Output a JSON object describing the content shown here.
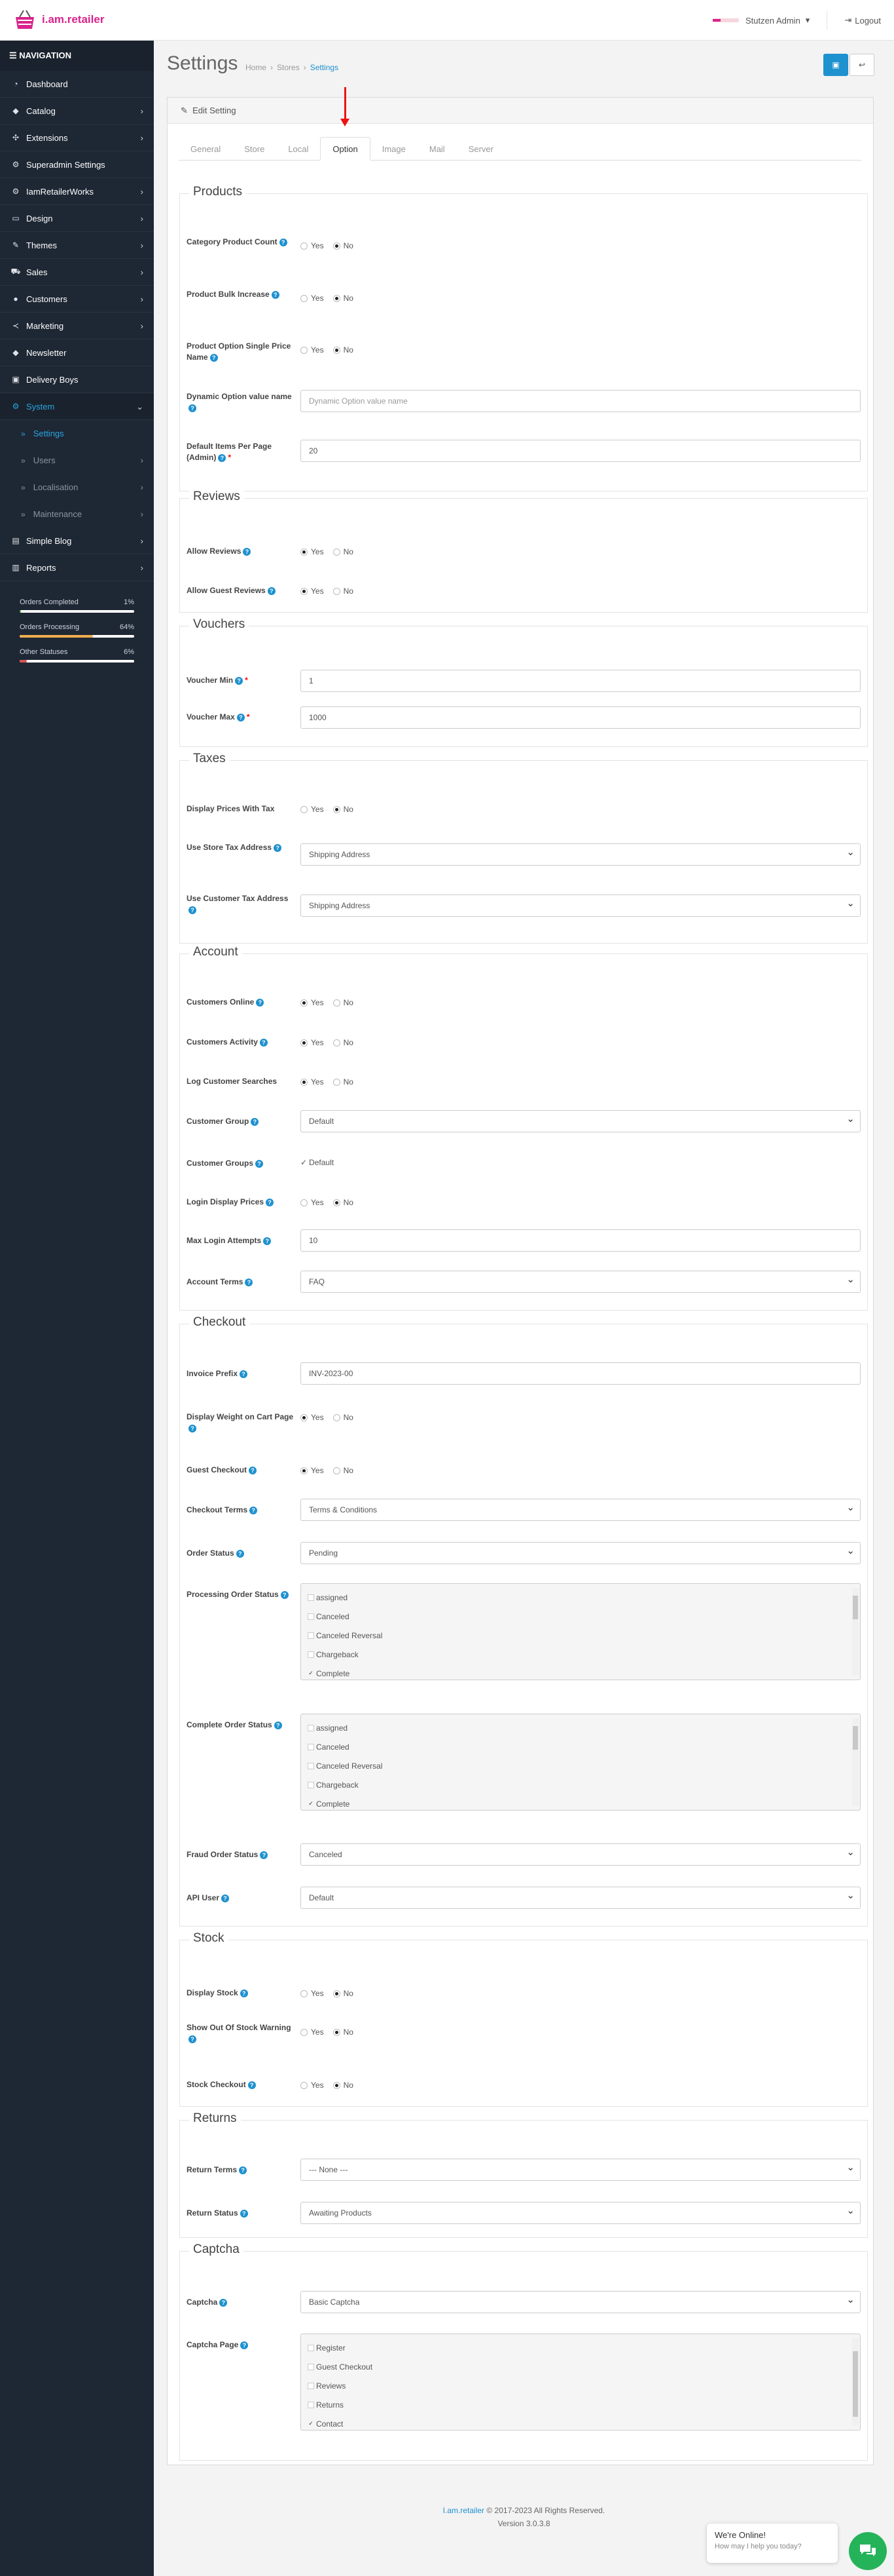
{
  "header": {
    "logo_text": "i.am.retailer",
    "user": "Stutzen Admin",
    "logout": "Logout"
  },
  "sidebar": {
    "heading": "NAVIGATION",
    "items": [
      {
        "label": "Dashboard",
        "icon": "dashboard-icon"
      },
      {
        "label": "Catalog",
        "icon": "tag-icon"
      },
      {
        "label": "Extensions",
        "icon": "puzzle-icon"
      },
      {
        "label": "Superadmin Settings",
        "icon": "cogs-icon"
      },
      {
        "label": "IamRetailerWorks",
        "icon": "cogs-icon"
      },
      {
        "label": "Design",
        "icon": "desktop-icon"
      },
      {
        "label": "Themes",
        "icon": "brush-icon"
      },
      {
        "label": "Sales",
        "icon": "cart-icon"
      },
      {
        "label": "Customers",
        "icon": "user-icon"
      },
      {
        "label": "Marketing",
        "icon": "share-icon"
      },
      {
        "label": "Newsletter",
        "icon": "tag-icon"
      },
      {
        "label": "Delivery Boys",
        "icon": "id-card-icon"
      },
      {
        "label": "System",
        "icon": "cog-icon"
      },
      {
        "label": "Settings",
        "icon": ""
      },
      {
        "label": "Users",
        "icon": ""
      },
      {
        "label": "Localisation",
        "icon": ""
      },
      {
        "label": "Maintenance",
        "icon": ""
      },
      {
        "label": "Simple Blog",
        "icon": "book-icon"
      },
      {
        "label": "Reports",
        "icon": "bar-chart-icon"
      }
    ],
    "stats": [
      {
        "label": "Orders Completed",
        "pct": "1%",
        "value": 0.01,
        "color": "#4caf50"
      },
      {
        "label": "Orders Processing",
        "pct": "64%",
        "value": 0.64,
        "color": "#f0ad4e"
      },
      {
        "label": "Other Statuses",
        "pct": "6%",
        "value": 0.06,
        "color": "#d9534f"
      }
    ]
  },
  "page": {
    "title": "Settings",
    "breadcrumb": [
      "Home",
      "Stores",
      "Settings"
    ],
    "panel_title": "Edit Setting",
    "tabs": [
      "General",
      "Store",
      "Local",
      "Option",
      "Image",
      "Mail",
      "Server"
    ],
    "active_tab": "Option"
  },
  "sections": {
    "products": {
      "title": "Products",
      "category_count": "Category Product Count",
      "bulk_increase": "Product Bulk Increase",
      "option_single": "Product Option Single Price Name",
      "dynamic_option": "Dynamic Option value name",
      "dynamic_placeholder": "Dynamic Option value name",
      "items_per_page": "Default Items Per Page (Admin)",
      "items_per_page_value": "20"
    },
    "reviews": {
      "title": "Reviews",
      "allow_reviews": "Allow Reviews",
      "allow_guest": "Allow Guest Reviews"
    },
    "vouchers": {
      "title": "Vouchers",
      "min": "Voucher Min",
      "min_value": "1",
      "max": "Voucher Max",
      "max_value": "1000"
    },
    "taxes": {
      "title": "Taxes",
      "display_prices": "Display Prices With Tax",
      "store_tax": "Use Store Tax Address",
      "store_tax_value": "Shipping Address",
      "customer_tax": "Use Customer Tax Address",
      "customer_tax_value": "Shipping Address"
    },
    "account": {
      "title": "Account",
      "online": "Customers Online",
      "activity": "Customers Activity",
      "log_searches": "Log Customer Searches",
      "customer_group": "Customer Group",
      "customer_group_value": "Default",
      "customer_groups": "Customer Groups",
      "customer_groups_value": "Default",
      "login_prices": "Login Display Prices",
      "max_login": "Max Login Attempts",
      "max_login_value": "10",
      "account_terms": "Account Terms",
      "account_terms_value": "FAQ"
    },
    "checkout": {
      "title": "Checkout",
      "invoice_prefix": "Invoice Prefix",
      "invoice_prefix_value": "INV-2023-00",
      "display_weight": "Display Weight on Cart Page",
      "guest_checkout": "Guest Checkout",
      "checkout_terms": "Checkout Terms",
      "checkout_terms_value": "Terms & Conditions",
      "order_status": "Order Status",
      "order_status_value": "Pending",
      "processing_status": "Processing Order Status",
      "complete_status": "Complete Order Status",
      "status_options": [
        "assigned",
        "Canceled",
        "Canceled Reversal",
        "Chargeback",
        "Complete"
      ],
      "fraud_status": "Fraud Order Status",
      "fraud_status_value": "Canceled",
      "api_user": "API User",
      "api_user_value": "Default"
    },
    "stock": {
      "title": "Stock",
      "display_stock": "Display Stock",
      "out_of_stock": "Show Out Of Stock Warning",
      "stock_checkout": "Stock Checkout"
    },
    "returns": {
      "title": "Returns",
      "return_terms": "Return Terms",
      "return_terms_value": " --- None --- ",
      "return_status": "Return Status",
      "return_status_value": "Awaiting Products"
    },
    "captcha": {
      "title": "Captcha",
      "captcha": "Captcha",
      "captcha_value": "Basic Captcha",
      "captcha_page": "Captcha Page",
      "page_options": [
        "Register",
        "Guest Checkout",
        "Reviews",
        "Returns",
        "Contact"
      ]
    }
  },
  "radio_labels": {
    "yes": "Yes",
    "no": "No"
  },
  "footer": {
    "brand": "I.am.retailer",
    "copyright": " © 2017-2023 All Rights Reserved.",
    "version": "Version 3.0.3.8"
  },
  "chat": {
    "title": "We're Online!",
    "subtitle": "How may I help you today?"
  },
  "colors": {
    "accent": "#1e91cf",
    "brand": "#d8238c",
    "sidebar": "#1e2734"
  }
}
